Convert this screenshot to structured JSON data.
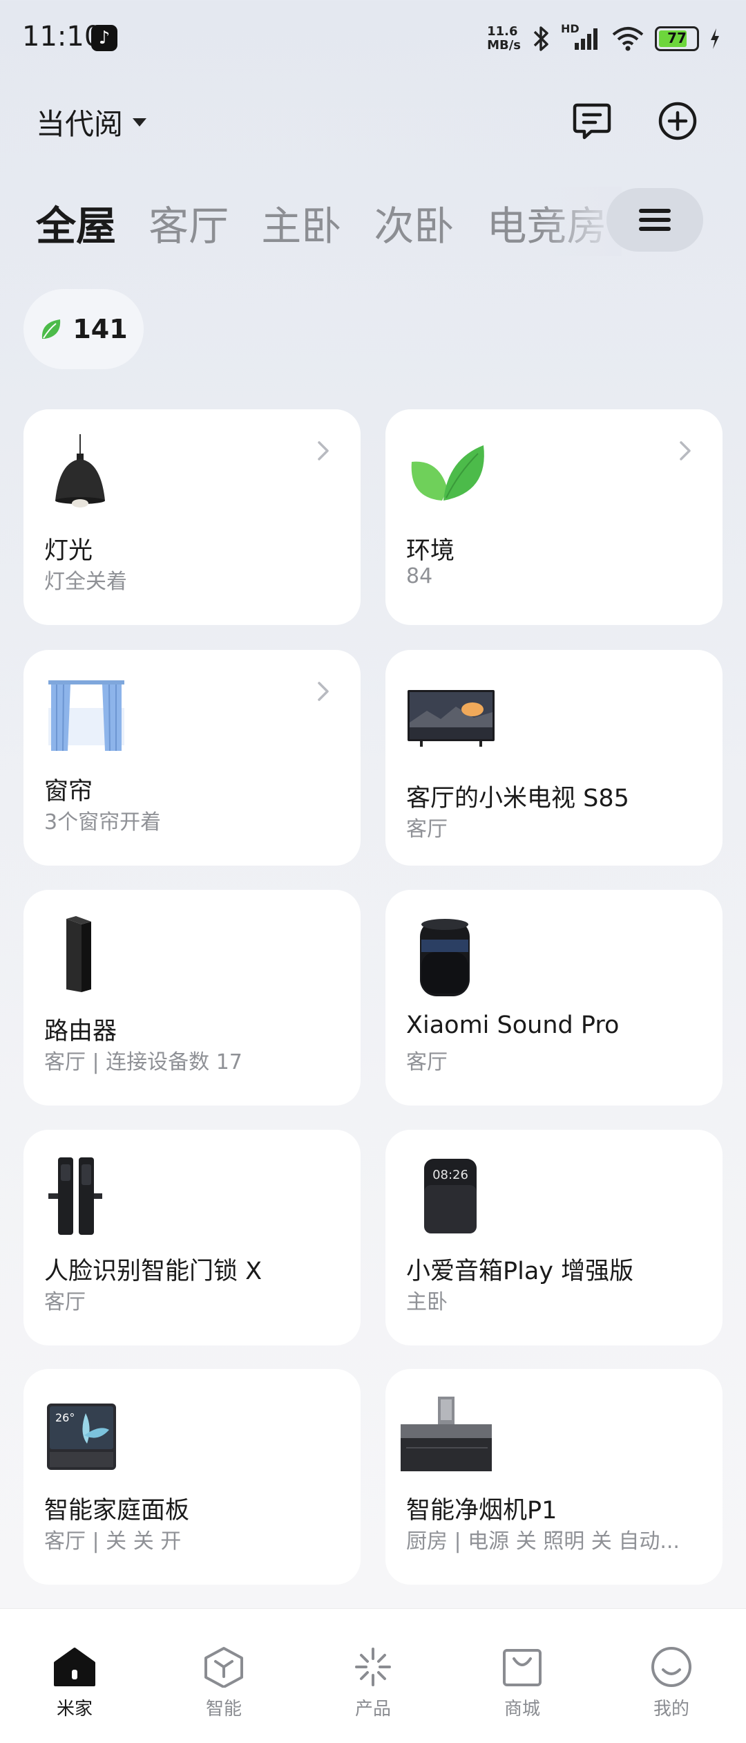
{
  "status_bar": {
    "time": "11:10",
    "net_speed_value": "11.6",
    "net_speed_unit": "MB/s",
    "signal_label": "HD",
    "battery": "77"
  },
  "header": {
    "home_name": "当代阅"
  },
  "room_tabs": [
    "全屋",
    "客厅",
    "主卧",
    "次卧",
    "电竞房"
  ],
  "eco_score": "141",
  "cards": [
    {
      "title": "灯光",
      "subtitle": "灯全关着"
    },
    {
      "title": "环境",
      "subtitle": "84"
    },
    {
      "title": "窗帘",
      "subtitle": "3个窗帘开着"
    },
    {
      "title": "客厅的小米电视 S85",
      "subtitle": "客厅"
    },
    {
      "title": "路由器",
      "subtitle": "客厅 | 连接设备数 17"
    },
    {
      "title": "Xiaomi Sound Pro",
      "subtitle": "客厅"
    },
    {
      "title": "人脸识别智能门锁 X",
      "subtitle": "客厅"
    },
    {
      "title": "小爱音箱Play 增强版",
      "subtitle": "主卧"
    },
    {
      "title": "智能家庭面板",
      "subtitle": "客厅 | 关 关 开"
    },
    {
      "title": "智能净烟机P1",
      "subtitle": "厨房 | 电源 关 照明 关 自动..."
    }
  ],
  "device_screen_text": {
    "speaker_clock": "08:26",
    "panel_temp": "26°"
  },
  "bottom_nav": [
    "米家",
    "智能",
    "产品",
    "商城",
    "我的"
  ],
  "colors": {
    "leaf_green": "#4cbb4a",
    "battery_green": "#6dd63c",
    "text_primary": "#1a1a1a",
    "text_secondary": "#8f9196"
  }
}
